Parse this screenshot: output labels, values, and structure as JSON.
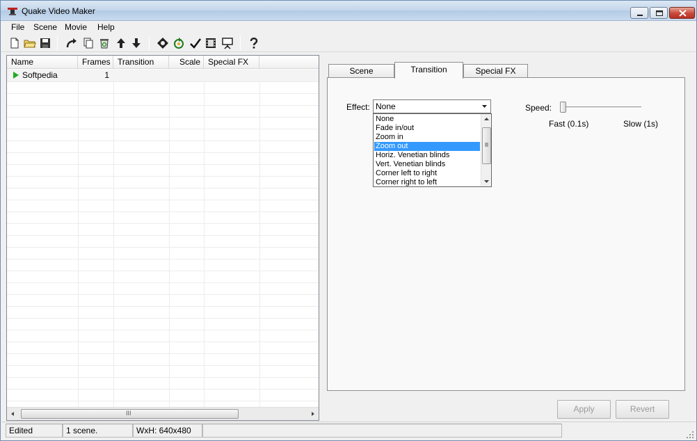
{
  "window": {
    "title": "Quake Video Maker"
  },
  "menu": {
    "file": "File",
    "scene": "Scene",
    "movie": "Movie",
    "help": "Help"
  },
  "toolbar": {
    "icons": [
      "new-icon",
      "open-icon",
      "save-icon",
      "redo-icon",
      "copy-icon",
      "recycle-icon",
      "move-up-icon",
      "move-down-icon",
      "render-icon",
      "refresh-icon",
      "check-icon",
      "film-icon",
      "presentation-icon",
      "help-icon"
    ]
  },
  "list": {
    "columns": [
      "Name",
      "Frames",
      "Transition",
      "Scale",
      "Special FX"
    ],
    "rows": [
      {
        "name": "Softpedia",
        "frames": "1",
        "transition": "",
        "scale": "",
        "special_fx": ""
      }
    ],
    "scroll_grip": "III"
  },
  "tabs": {
    "scene": "Scene",
    "transition": "Transition",
    "special_fx": "Special FX",
    "active": "Transition"
  },
  "transition": {
    "effect_label": "Effect:",
    "effect_value": "None",
    "options": [
      "None",
      "Fade in/out",
      "Zoom in",
      "Zoom out",
      "Horiz. Venetian blinds",
      "Vert. Venetian blinds",
      "Corner left to right",
      "Corner right to left"
    ],
    "highlighted_option": "Zoom out",
    "speed_label": "Speed:",
    "speed_fast": "Fast (0.1s)",
    "speed_slow": "Slow (1s)",
    "speed_level": 0
  },
  "buttons": {
    "apply": "Apply",
    "revert": "Revert"
  },
  "status": {
    "edited": "Edited",
    "scenes": "1 scene.",
    "size": "WxH: 640x480",
    "extra": ""
  },
  "colors": {
    "selection": "#3399ff",
    "play_arrow": "#22aa22"
  }
}
